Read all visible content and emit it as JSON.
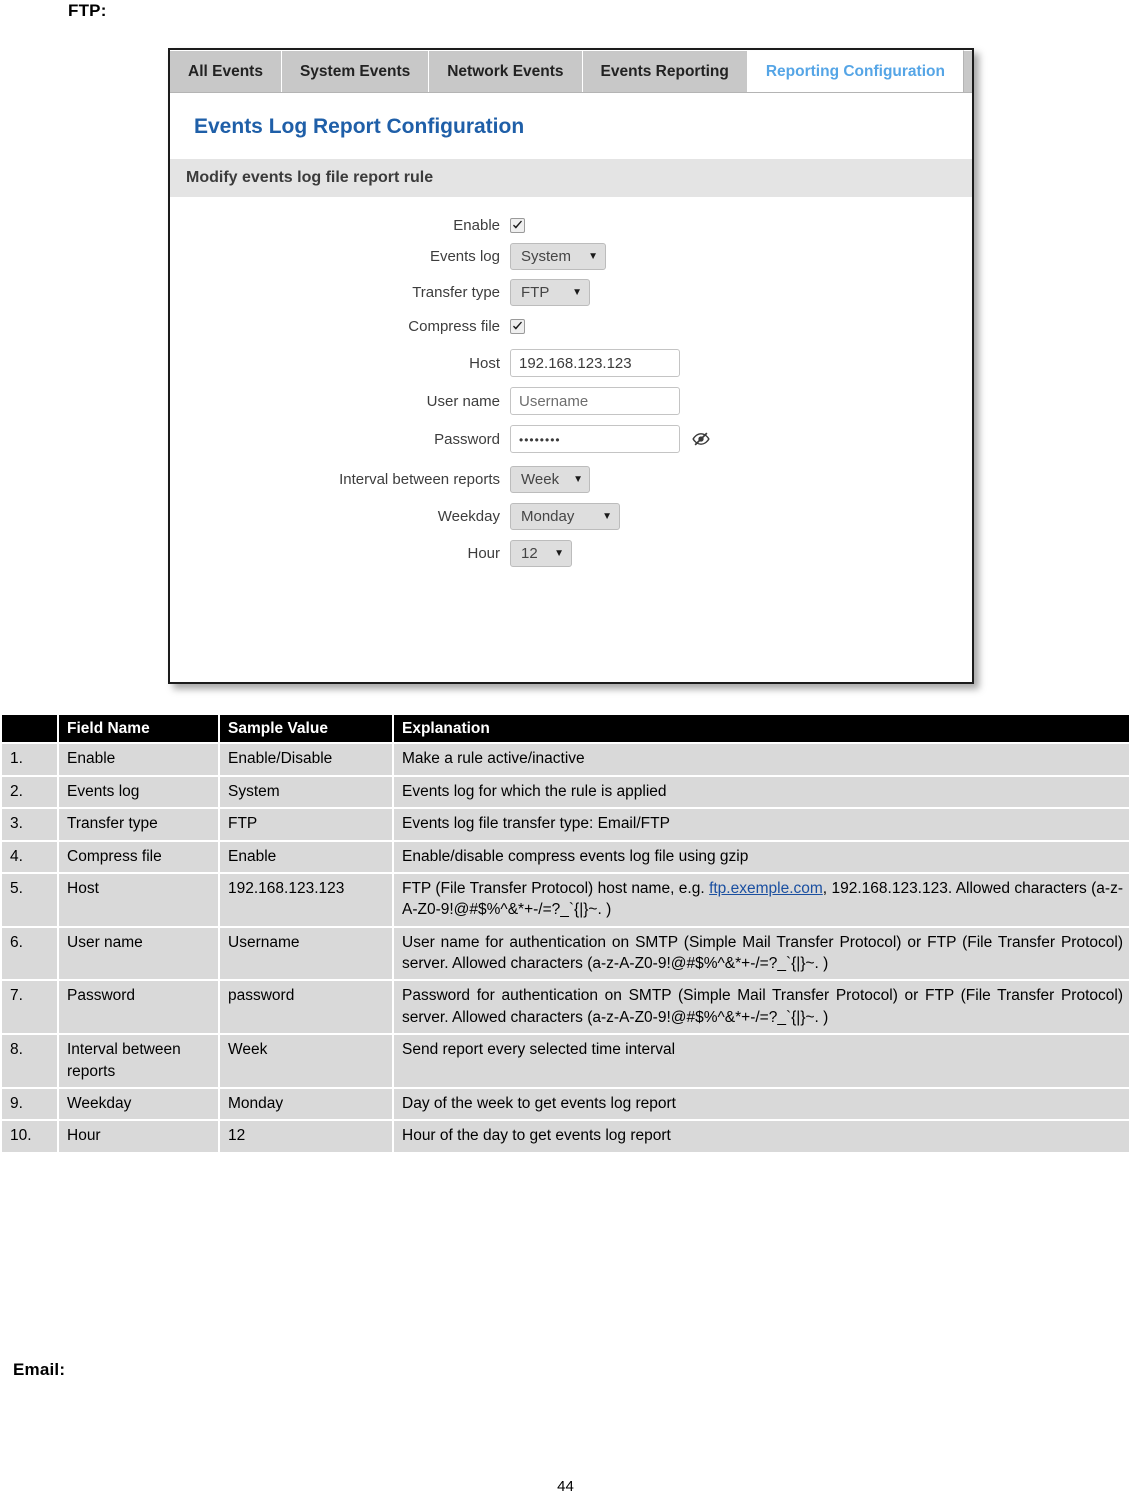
{
  "document": {
    "ftp_label": "FTP:",
    "email_label": "Email:",
    "page_number": "44"
  },
  "screenshot": {
    "tabs": [
      {
        "label": "All Events",
        "active": false
      },
      {
        "label": "System Events",
        "active": false
      },
      {
        "label": "Network Events",
        "active": false
      },
      {
        "label": "Events Reporting",
        "active": false
      },
      {
        "label": "Reporting Configuration",
        "active": true
      }
    ],
    "panel_title": "Events Log Report Configuration",
    "section_title": "Modify events log file report rule",
    "accent_color": "#1f5fa8",
    "active_tab_color": "#55a5e6",
    "form": {
      "enable": {
        "label": "Enable",
        "checked": true
      },
      "events_log": {
        "label": "Events log",
        "value": "System"
      },
      "transfer_type": {
        "label": "Transfer type",
        "value": "FTP"
      },
      "compress_file": {
        "label": "Compress file",
        "checked": true
      },
      "host": {
        "label": "Host",
        "value": "192.168.123.123"
      },
      "user_name": {
        "label": "User name",
        "value": "Username"
      },
      "password": {
        "label": "Password",
        "value": "••••••••"
      },
      "interval": {
        "label": "Interval between reports",
        "value": "Week"
      },
      "weekday": {
        "label": "Weekday",
        "value": "Monday"
      },
      "hour": {
        "label": "Hour",
        "value": "12"
      }
    }
  },
  "table": {
    "headers": [
      "",
      "Field Name",
      "Sample Value",
      "Explanation"
    ],
    "rows": [
      {
        "num": "1.",
        "field": "Enable",
        "value": "Enable/Disable",
        "explanation": "Make a rule active/inactive"
      },
      {
        "num": "2.",
        "field": "Events log",
        "value": "System",
        "explanation": "Events log for which the rule is applied"
      },
      {
        "num": "3.",
        "field": "Transfer type",
        "value": "FTP",
        "explanation": "Events log file transfer type: Email/FTP"
      },
      {
        "num": "4.",
        "field": "Compress  file",
        "value": "Enable",
        "explanation": "Enable/disable compress events log file using gzip"
      },
      {
        "num": "5.",
        "field": "Host",
        "value": "192.168.123.123",
        "explanation_pre": "FTP (File Transfer Protocol) host name, e.g. ",
        "explanation_link": "ftp.exemple.com",
        "explanation_post": ", 192.168.123.123. Allowed characters (a-z-A-Z0-9!@#$%^&*+-/=?_`{|}~. )"
      },
      {
        "num": "6.",
        "field": "User name",
        "value": "Username",
        "explanation": "User name for authentication on SMTP (Simple Mail Transfer Protocol) or FTP (File Transfer Protocol) server. Allowed characters (a-z-A-Z0-9!@#$%^&*+-/=?_`{|}~. )"
      },
      {
        "num": "7.",
        "field": "Password",
        "value": "password",
        "explanation": "Password for authentication on SMTP (Simple Mail Transfer Protocol) or FTP (File Transfer Protocol) server. Allowed characters (a-z-A-Z0-9!@#$%^&*+-/=?_`{|}~. )"
      },
      {
        "num": "8.",
        "field": "Interval between reports",
        "value": "Week",
        "explanation": "Send report every selected time interval"
      },
      {
        "num": "9.",
        "field": "Weekday",
        "value": "Monday",
        "explanation": "Day of the week to get events log report"
      },
      {
        "num": "10.",
        "field": "Hour",
        "value": "12",
        "explanation": "Hour of the day to get events log report"
      }
    ]
  },
  "icons": {
    "checkmark": "check-icon",
    "caret": "chevron-down-icon",
    "eye_slash": "eye-slash-icon"
  }
}
